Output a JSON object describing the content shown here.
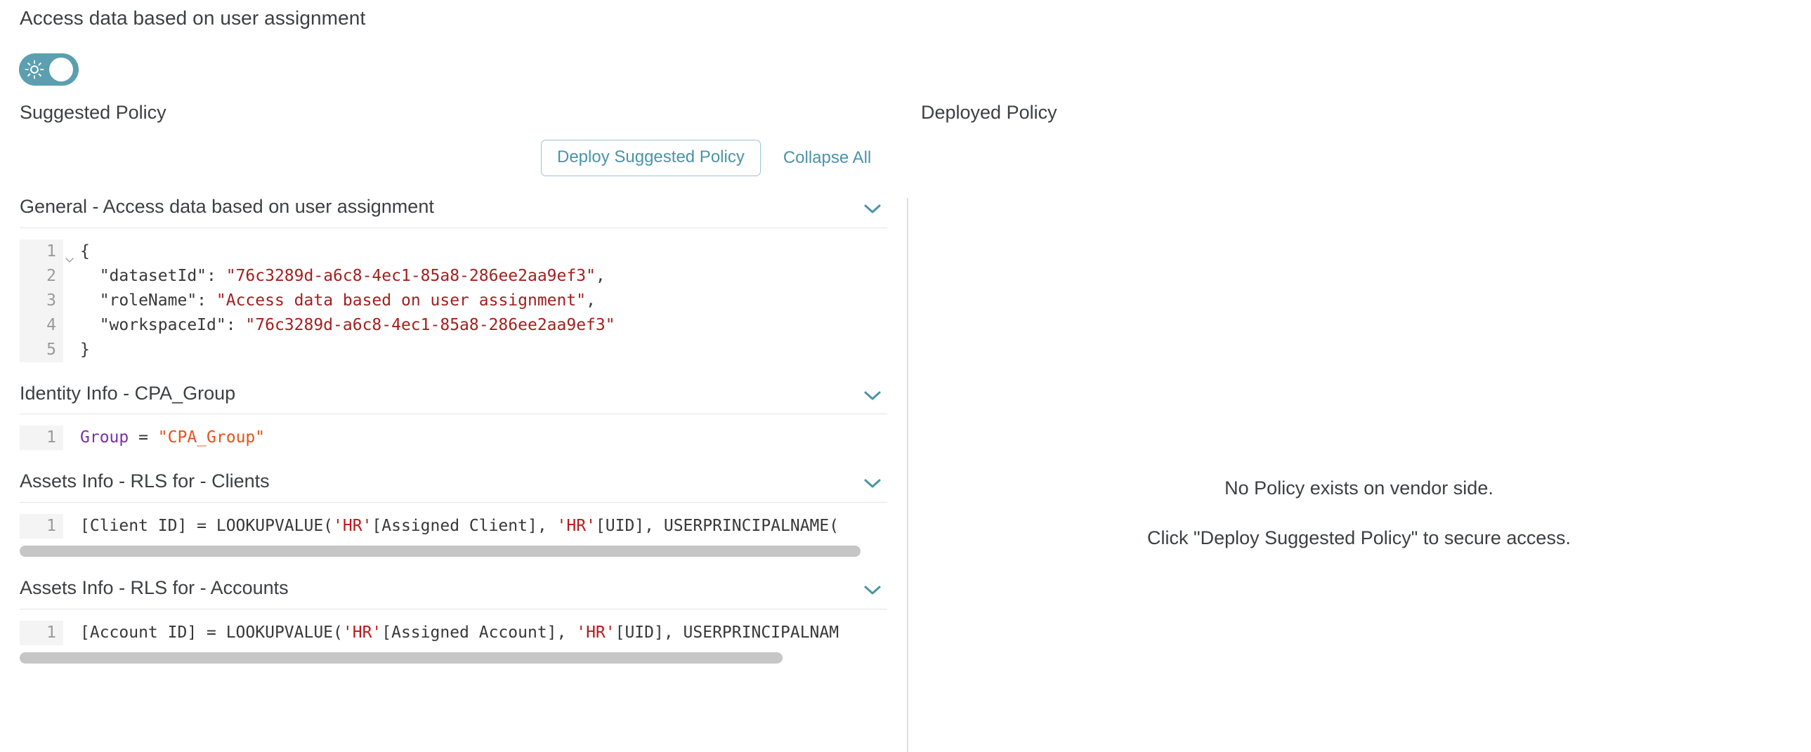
{
  "page": {
    "role_title": "Access data based on user assignment",
    "accent_color": "#4a94a8",
    "toggle_color": "#5b9fb0"
  },
  "toggle": {
    "name": "theme-toggle",
    "icon": "sun-icon",
    "state": "on"
  },
  "columns": {
    "left_title": "Suggested Policy",
    "right_title": "Deployed Policy"
  },
  "actions": {
    "deploy_label": "Deploy Suggested Policy",
    "collapse_label": "Collapse All"
  },
  "sections": [
    {
      "title": "General - Access data based on user assignment",
      "chevron": "chevron-down-icon",
      "lang": "json",
      "has_scrollbar": false,
      "lines": [
        {
          "n": "1",
          "fold": true,
          "parts": [
            {
              "t": "{",
              "c": "plain"
            }
          ]
        },
        {
          "n": "2",
          "fold": false,
          "parts": [
            {
              "t": "  \"datasetId\": ",
              "c": "plain"
            },
            {
              "t": "\"76c3289d-a6c8-4ec1-85a8-286ee2aa9ef3\"",
              "c": "json-str"
            },
            {
              "t": ",",
              "c": "plain"
            }
          ]
        },
        {
          "n": "3",
          "fold": false,
          "parts": [
            {
              "t": "  \"roleName\": ",
              "c": "plain"
            },
            {
              "t": "\"Access data based on user assignment\"",
              "c": "json-str"
            },
            {
              "t": ",",
              "c": "plain"
            }
          ]
        },
        {
          "n": "4",
          "fold": false,
          "parts": [
            {
              "t": "  \"workspaceId\": ",
              "c": "plain"
            },
            {
              "t": "\"76c3289d-a6c8-4ec1-85a8-286ee2aa9ef3\"",
              "c": "json-str"
            }
          ]
        },
        {
          "n": "5",
          "fold": false,
          "parts": [
            {
              "t": "}",
              "c": "plain"
            }
          ]
        }
      ]
    },
    {
      "title": "Identity Info - CPA_Group",
      "chevron": "chevron-down-icon",
      "lang": "dax",
      "has_scrollbar": false,
      "lines": [
        {
          "n": "1",
          "fold": false,
          "parts": [
            {
              "t": "Group",
              "c": "dax-var"
            },
            {
              "t": " = ",
              "c": "plain"
            },
            {
              "t": "\"CPA_Group\"",
              "c": "dax-str"
            }
          ]
        }
      ]
    },
    {
      "title": "Assets Info - RLS for - Clients",
      "chevron": "chevron-down-icon",
      "lang": "dax",
      "has_scrollbar": true,
      "scroll_thumb_width": "97%",
      "lines": [
        {
          "n": "1",
          "fold": false,
          "parts": [
            {
              "t": "[Client ID] = LOOKUPVALUE(",
              "c": "plain"
            },
            {
              "t": "'HR'",
              "c": "dax-tbl"
            },
            {
              "t": "[Assigned Client], ",
              "c": "plain"
            },
            {
              "t": "'HR'",
              "c": "dax-tbl"
            },
            {
              "t": "[UID], USERPRINCIPALNAME(",
              "c": "plain"
            }
          ]
        }
      ]
    },
    {
      "title": "Assets Info - RLS for - Accounts",
      "chevron": "chevron-down-icon",
      "lang": "dax",
      "has_scrollbar": true,
      "scroll_thumb_width": "88%",
      "lines": [
        {
          "n": "1",
          "fold": false,
          "parts": [
            {
              "t": "[Account ID] = LOOKUPVALUE(",
              "c": "plain"
            },
            {
              "t": "'HR'",
              "c": "dax-tbl"
            },
            {
              "t": "[Assigned Account], ",
              "c": "plain"
            },
            {
              "t": "'HR'",
              "c": "dax-tbl"
            },
            {
              "t": "[UID], USERPRINCIPALNAM",
              "c": "plain"
            }
          ]
        }
      ]
    }
  ],
  "empty_state": {
    "line1": "No Policy exists on vendor side.",
    "line2": "Click \"Deploy Suggested Policy\" to secure access."
  }
}
